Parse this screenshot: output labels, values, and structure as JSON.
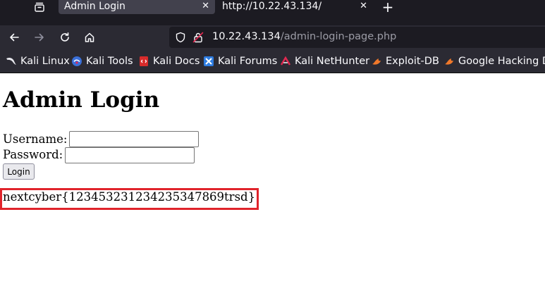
{
  "browser": {
    "tabs": [
      {
        "title": "Admin Login",
        "active": true
      },
      {
        "title": "http://10.22.43.134/",
        "active": false
      }
    ],
    "url": {
      "host": "10.22.43.134",
      "path": "/admin-login-page.php"
    },
    "bookmarks": [
      {
        "label": "Kali Linux",
        "icon": "kali-dragon-icon"
      },
      {
        "label": "Kali Tools",
        "icon": "kali-tools-icon"
      },
      {
        "label": "Kali Docs",
        "icon": "kali-docs-icon"
      },
      {
        "label": "Kali Forums",
        "icon": "kali-forums-icon"
      },
      {
        "label": "Kali NetHunter",
        "icon": "kali-nethunter-icon"
      },
      {
        "label": "Exploit-DB",
        "icon": "exploit-db-icon"
      },
      {
        "label": "Google Hacking DB",
        "icon": "ghdb-icon"
      }
    ],
    "colors": {
      "tabstrip": "#1c1b22",
      "toolbar": "#2b2a33",
      "text": "#fbfbfe",
      "highlight_box": "#e0242b"
    }
  },
  "page": {
    "heading": "Admin Login",
    "username_label": "Username:",
    "password_label": "Password:",
    "username_value": "",
    "password_value": "",
    "login_button": "Login",
    "flag": "nextcyber{12345323123423534786​9trsd}"
  }
}
